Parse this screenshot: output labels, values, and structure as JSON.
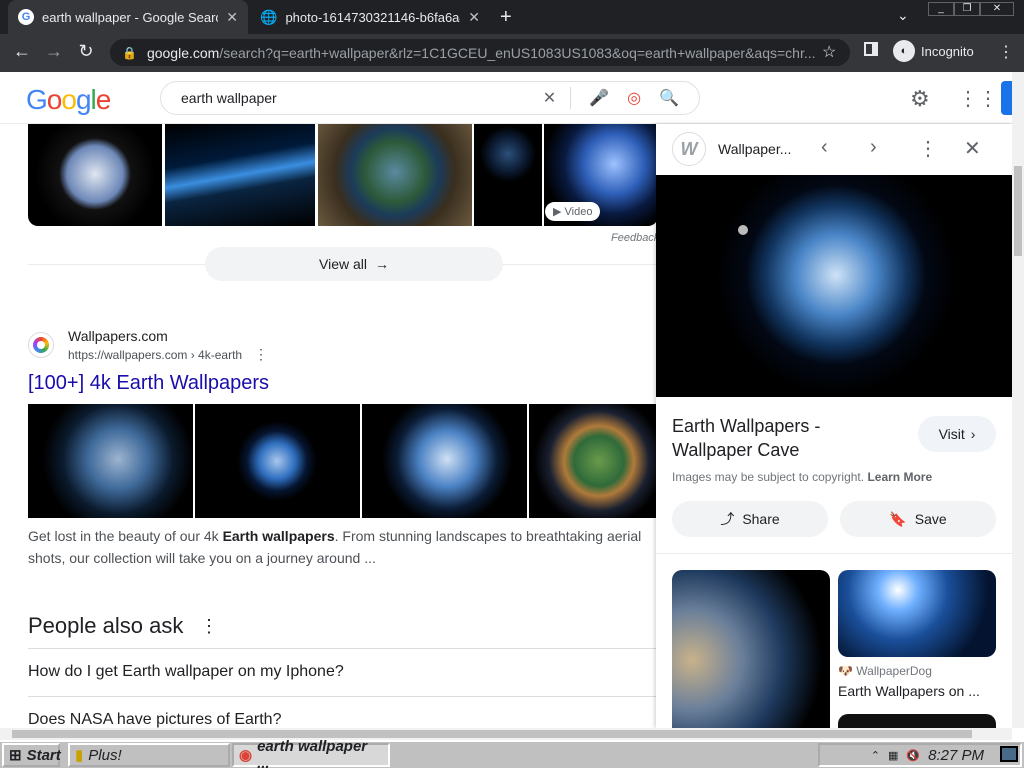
{
  "browser": {
    "tabs": [
      {
        "title": "earth wallpaper - Google Search",
        "active": true
      },
      {
        "title": "photo-1614730321146-b6fa6a46"
      }
    ],
    "url_host": "google.com",
    "url_path": "/search?q=earth+wallpaper&rlz=1C1GCEU_enUS1083US1083&oq=earth+wallpaper&aqs=chr...",
    "incognito_label": "Incognito"
  },
  "google": {
    "logo_letters": [
      "G",
      "o",
      "o",
      "g",
      "l",
      "e"
    ],
    "query": "earth wallpaper",
    "video_badge": "Video",
    "feedback": "Feedback",
    "view_all": "View all"
  },
  "result": {
    "site": "Wallpapers.com",
    "url": "https://wallpapers.com › 4k-earth",
    "title": "[100+] 4k Earth Wallpapers",
    "snippet_pre": "Get lost in the beauty of our 4k ",
    "snippet_bold": "Earth wallpapers",
    "snippet_post": ". From stunning landscapes to breathtaking aerial shots, our collection will take you on a journey around ..."
  },
  "paa": {
    "heading": "People also ask",
    "questions": [
      "How do I get Earth wallpaper on my Iphone?",
      "Does NASA have pictures of Earth?"
    ]
  },
  "panel": {
    "source": "Wallpaper...",
    "title": "Earth Wallpapers - Wallpaper Cave",
    "visit": "Visit",
    "copyright": "Images may be subject to copyright.",
    "learn_more": "Learn More",
    "share": "Share",
    "save": "Save",
    "related_source": "WallpaperDog",
    "related_title": "Earth Wallpapers on ..."
  },
  "taskbar": {
    "start": "Start",
    "items": [
      "Plus!",
      "earth wallpaper ..."
    ],
    "time": "8:27 PM"
  },
  "colors": {
    "link": "#1a0dab",
    "accent": "#1a73e8"
  }
}
